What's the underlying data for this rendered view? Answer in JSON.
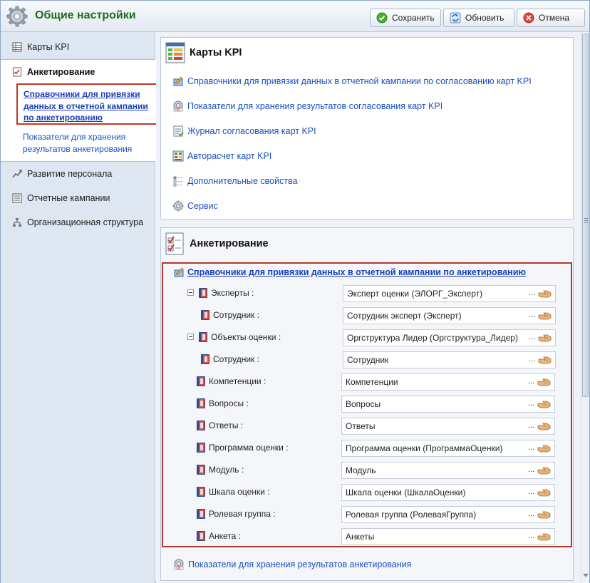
{
  "window": {
    "title": "Общие настройки"
  },
  "toolbar": {
    "save_label": "Сохранить",
    "refresh_label": "Обновить",
    "cancel_label": "Отмена"
  },
  "sidebar": {
    "items": [
      {
        "label": "Карты KPI",
        "icon": "grid-icon"
      },
      {
        "label": "Анкетирование",
        "icon": "checklist-icon"
      },
      {
        "label": "Развитие персонала",
        "icon": "growth-icon"
      },
      {
        "label": "Отчетные кампании",
        "icon": "list-icon"
      },
      {
        "label": "Организационная структура",
        "icon": "org-chart-icon"
      }
    ],
    "active_subitems": [
      "Справочники для привязки данных в отчетной кампании по анкетированию",
      "Показатели для хранения результатов анкетирования"
    ]
  },
  "kpi_panel": {
    "title": "Карты KPI",
    "links": [
      {
        "label": "Справочники для привязки данных в отчетной кампании по согласованию карт KPI",
        "icon": "pencil-book-icon"
      },
      {
        "label": "Показатели для хранения результатов согласования карт KPI",
        "icon": "abc-gear-icon"
      },
      {
        "label": "Журнал согласования карт KPI",
        "icon": "journal-icon"
      },
      {
        "label": "Авторасчет карт KPI",
        "icon": "calc-icon"
      },
      {
        "label": "Дополнительные свойства",
        "icon": "properties-icon"
      },
      {
        "label": "Сервис",
        "icon": "gear-icon"
      }
    ]
  },
  "survey_panel": {
    "title": "Анкетирование",
    "section_link": "Справочники для привязки данных в отчетной кампании по анкетированию",
    "rows": [
      {
        "label": "Эксперты :",
        "value": "Эксперт оценки (ЭЛОРГ_Эксперт)",
        "level": 0,
        "toggle": true
      },
      {
        "label": "Сотрудник :",
        "value": "Сотрудник эксперт (Эксперт)",
        "level": 1,
        "toggle": false
      },
      {
        "label": "Объекты оценки :",
        "value": "Оргструктура Лидер (Оргструктура_Лидер)",
        "level": 0,
        "toggle": true
      },
      {
        "label": "Сотрудник :",
        "value": "Сотрудник",
        "level": 1,
        "toggle": false
      },
      {
        "label": "Компетенции :",
        "value": "Компетенции",
        "level": 2,
        "toggle": false
      },
      {
        "label": "Вопросы :",
        "value": "Вопросы",
        "level": 2,
        "toggle": false
      },
      {
        "label": "Ответы :",
        "value": "Ответы",
        "level": 2,
        "toggle": false
      },
      {
        "label": "Программа оценки :",
        "value": "Программа оценки (ПрограммаОценки)",
        "level": 2,
        "toggle": false
      },
      {
        "label": "Модуль :",
        "value": "Модуль",
        "level": 2,
        "toggle": false
      },
      {
        "label": "Шкала оценки :",
        "value": "Шкала оценки (ШкалаОценки)",
        "level": 2,
        "toggle": false
      },
      {
        "label": "Ролевая группа :",
        "value": "Ролевая группа (РолеваяГруппа)",
        "level": 2,
        "toggle": false
      },
      {
        "label": "Анкета :",
        "value": "Анкеты",
        "level": 2,
        "toggle": false
      }
    ],
    "field_button_text": "...",
    "bottom_link": "Показатели для хранения результатов анкетирования"
  },
  "colors": {
    "title_green": "#1d6d1d",
    "link_blue": "#1a4fc0",
    "highlight_red": "#c0392b",
    "sidebar_bg": "#dde6f1"
  }
}
